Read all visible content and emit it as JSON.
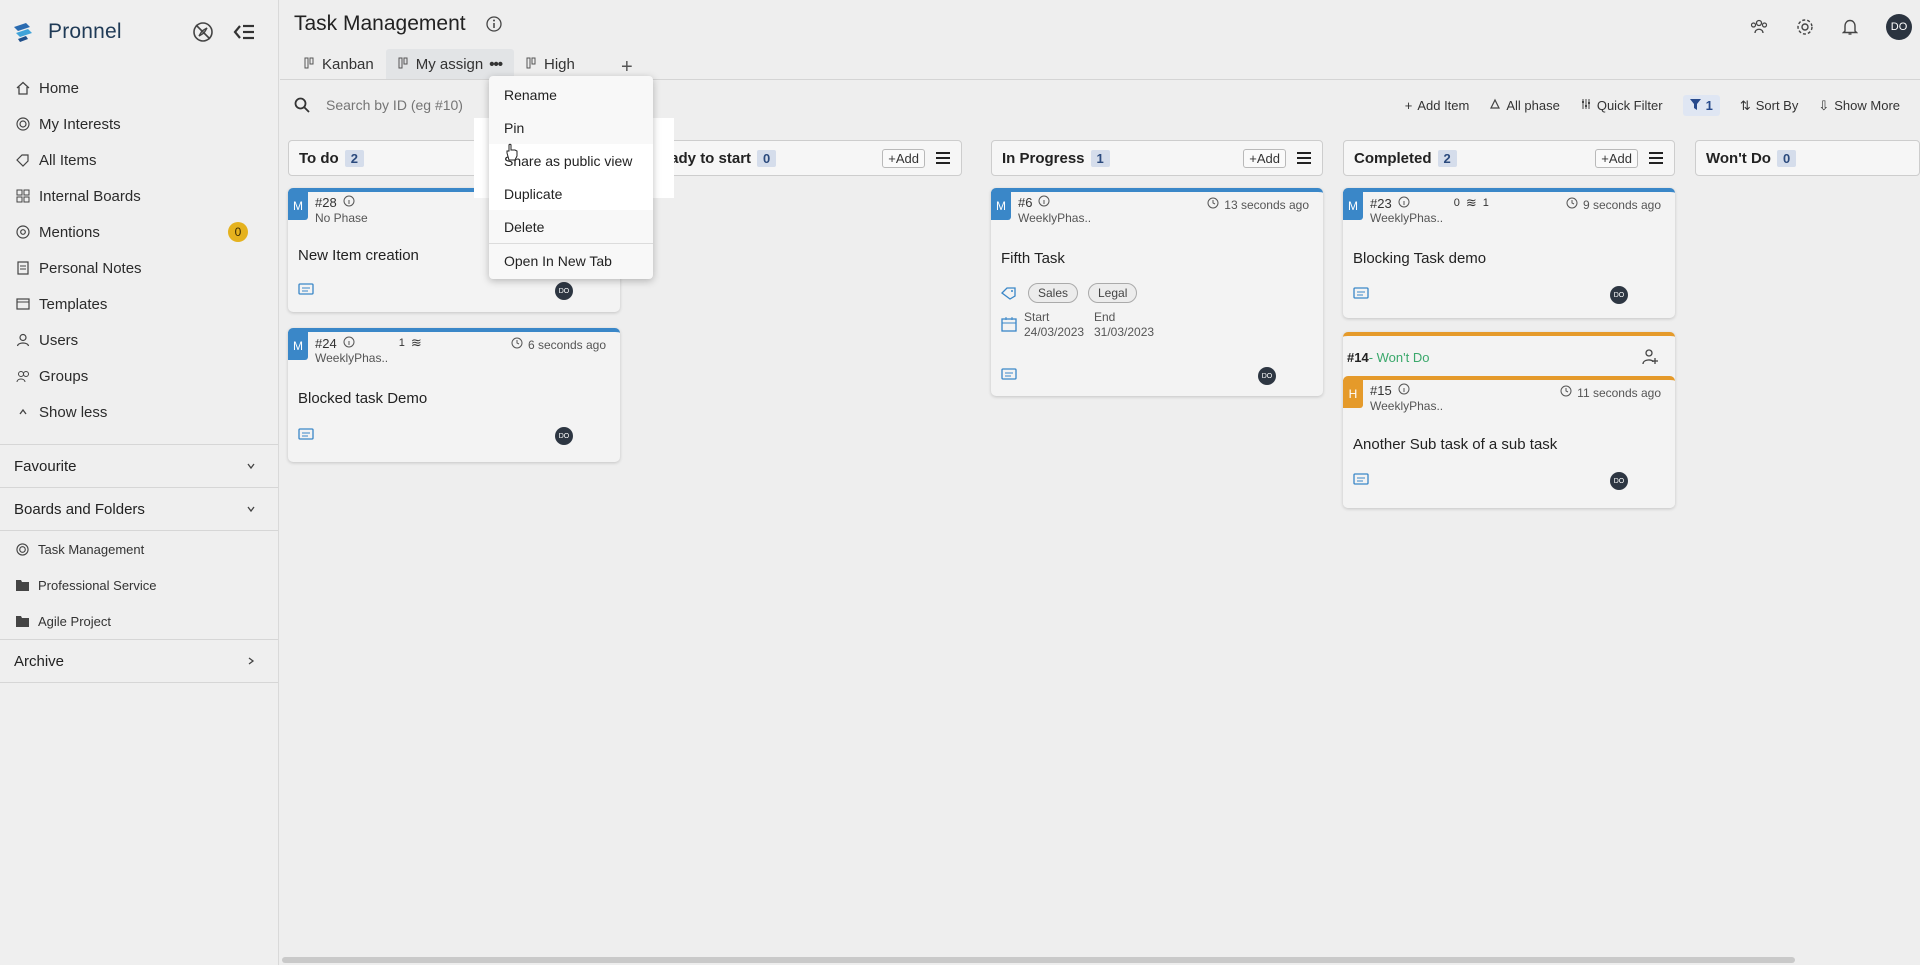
{
  "app": {
    "name": "Pronnel"
  },
  "sidebar": {
    "nav": [
      {
        "label": "Home",
        "icon": "home-icon"
      },
      {
        "label": "My Interests",
        "icon": "target-icon"
      },
      {
        "label": "All Items",
        "icon": "tag-icon"
      },
      {
        "label": "Internal Boards",
        "icon": "grid-icon"
      },
      {
        "label": "Mentions",
        "icon": "at-icon",
        "count": "0"
      },
      {
        "label": "Personal Notes",
        "icon": "note-icon"
      },
      {
        "label": "Templates",
        "icon": "template-icon"
      },
      {
        "label": "Users",
        "icon": "user-icon"
      },
      {
        "label": "Groups",
        "icon": "group-icon"
      },
      {
        "label": "Show less",
        "icon": "chevron-up-icon"
      }
    ],
    "favourite": "Favourite",
    "boards_and_folders": "Boards and Folders",
    "folders": [
      {
        "label": "Task Management",
        "icon": "target-icon"
      },
      {
        "label": "Professional Service",
        "icon": "folder-icon"
      },
      {
        "label": "Agile Project",
        "icon": "folder-icon"
      }
    ],
    "archive": "Archive"
  },
  "header": {
    "title": "Task Management",
    "avatar": "DO"
  },
  "tabs": [
    {
      "label": "Kanban"
    },
    {
      "label": "My assign"
    },
    {
      "label": "High"
    }
  ],
  "search": {
    "placeholder": "Search by ID (eg #10)"
  },
  "toolbar": {
    "add_item": "Add Item",
    "all_phase": "All phase",
    "quick_filter": "Quick Filter",
    "filter_count": "1",
    "sort_by": "Sort By",
    "show_more": "Show More"
  },
  "columns": [
    {
      "title": "To do",
      "count": "2"
    },
    {
      "title": "Ready to start",
      "count": "0",
      "add": "+Add"
    },
    {
      "title": "In Progress",
      "count": "1",
      "add": "+Add"
    },
    {
      "title": "Completed",
      "count": "2",
      "add": "+Add"
    },
    {
      "title": "Won't Do",
      "count": "0"
    }
  ],
  "cards": {
    "c28": {
      "prio": "M",
      "id": "#28",
      "phase": "No Phase",
      "title": "New Item creation",
      "avatar": "DO"
    },
    "c24": {
      "prio": "M",
      "id": "#24",
      "dep": "1",
      "phase": "WeeklyPhas..",
      "time": "6 seconds ago",
      "title": "Blocked task Demo",
      "avatar": "DO"
    },
    "c6": {
      "prio": "M",
      "id": "#6",
      "phase": "WeeklyPhas..",
      "time": "13 seconds ago",
      "title": "Fifth Task",
      "tags": [
        "Sales",
        "Legal"
      ],
      "start_label": "Start",
      "start": "24/03/2023",
      "end_label": "End",
      "end": "31/03/2023",
      "avatar": "DO"
    },
    "c23": {
      "prio": "M",
      "id": "#23",
      "dep_a": "0",
      "dep_b": "1",
      "phase": "WeeklyPhas..",
      "time": "9 seconds ago",
      "title": "Blocking Task demo",
      "avatar": "DO"
    },
    "g14": {
      "id": "#14",
      "status": "- Won't Do"
    },
    "c15": {
      "prio": "H",
      "id": "#15",
      "phase": "WeeklyPhas..",
      "time": "11 seconds ago",
      "title": "Another Sub task of a sub task",
      "avatar": "DO"
    }
  },
  "context_menu": {
    "items": [
      "Rename",
      "Pin",
      "Share as public view",
      "Duplicate",
      "Delete",
      "Open In New Tab"
    ]
  },
  "colors": {
    "accent": "#3a87c8",
    "high": "#e59a2a",
    "wontdo": "#3aa86b"
  }
}
